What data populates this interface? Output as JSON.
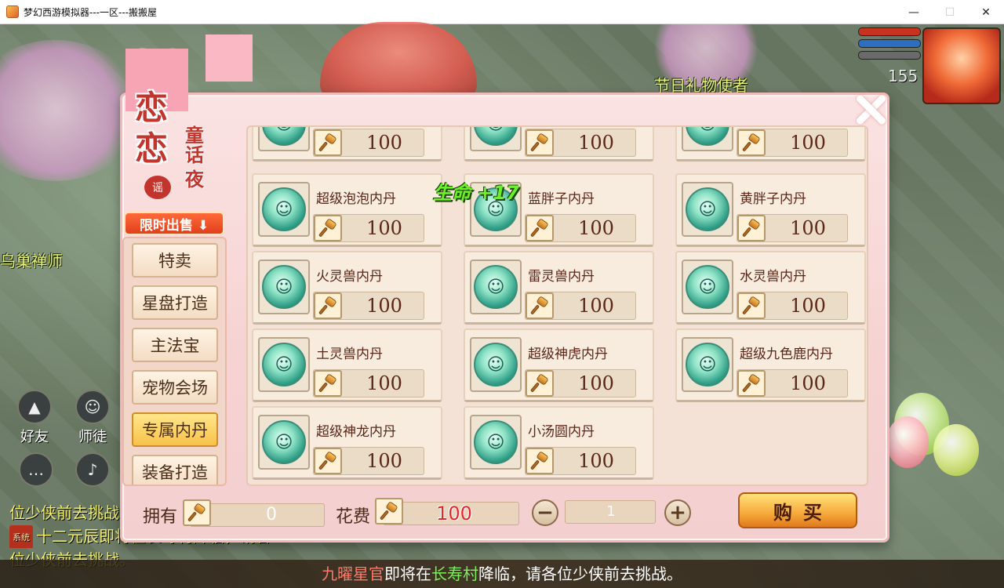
{
  "window": {
    "title": "梦幻西游模拟器---一区---搬搬屋",
    "minimize": "—",
    "maximize": "☐",
    "close": "✕"
  },
  "scene": {
    "npc_names": [
      "节日礼物使者",
      "乌巢禅师"
    ],
    "level": "155",
    "side_buttons": [
      {
        "label": "好友",
        "icon": "hat-icon"
      },
      {
        "label": "师徒",
        "icon": "master-icon"
      }
    ],
    "hud_colors": [
      "#c8321e",
      "#2d6ec0",
      "#6a6a6a"
    ],
    "chat": [
      {
        "tag": "",
        "text": "位少侠前去挑战。"
      },
      {
        "tag": "系统",
        "text": "十二元辰即将在长寿村降临，请各"
      },
      {
        "tag": "",
        "text": "位少侠前去挑战。"
      }
    ],
    "broadcast": {
      "part1": "九曜星官",
      "part2": "即将在",
      "part3": "长寿村",
      "part4": "降临，请各位少侠前去挑战。"
    }
  },
  "shop": {
    "banner": {
      "title_char_1": "恋",
      "title_char_2": "恋",
      "subtitle_1": "童话",
      "subtitle_2": "夜",
      "badge": "谣",
      "sale_tag": "限时出售 ⬇"
    },
    "categories": [
      {
        "label": "特卖",
        "active": false
      },
      {
        "label": "星盘打造",
        "active": false
      },
      {
        "label": "主法宝",
        "active": false
      },
      {
        "label": "宠物会场",
        "active": false
      },
      {
        "label": "专属内丹",
        "active": true
      },
      {
        "label": "装备打造",
        "active": false
      }
    ],
    "items": [
      {
        "name": "",
        "price": "100",
        "icon": "pet-face-icon"
      },
      {
        "name": "",
        "price": "100",
        "icon": "pet-face-icon"
      },
      {
        "name": "",
        "price": "100",
        "icon": "pet-face-icon"
      },
      {
        "name": "超级泡泡内丹",
        "price": "100",
        "icon": "pet-face-icon"
      },
      {
        "name": "蓝胖子内丹",
        "price": "100",
        "icon": "pet-face-icon"
      },
      {
        "name": "黄胖子内丹",
        "price": "100",
        "icon": "pet-face-icon"
      },
      {
        "name": "火灵兽内丹",
        "price": "100",
        "icon": "pet-face-icon"
      },
      {
        "name": "雷灵兽内丹",
        "price": "100",
        "icon": "pet-face-icon"
      },
      {
        "name": "水灵兽内丹",
        "price": "100",
        "icon": "pet-face-icon"
      },
      {
        "name": "土灵兽内丹",
        "price": "100",
        "icon": "pet-face-icon"
      },
      {
        "name": "超级神虎内丹",
        "price": "100",
        "icon": "pet-face-icon"
      },
      {
        "name": "超级九色鹿内丹",
        "price": "100",
        "icon": "pet-face-icon"
      },
      {
        "name": "超级神龙内丹",
        "price": "100",
        "icon": "pet-face-icon"
      },
      {
        "name": "小汤圆内丹",
        "price": "100",
        "icon": "pet-face-icon"
      }
    ],
    "float_text": "生命 +17",
    "footer": {
      "own_label": "拥有",
      "own_value": "0",
      "cost_label": "花费",
      "cost_value": "100",
      "minus": "−",
      "quantity": "1",
      "plus": "+",
      "buy_label": "购买"
    }
  }
}
